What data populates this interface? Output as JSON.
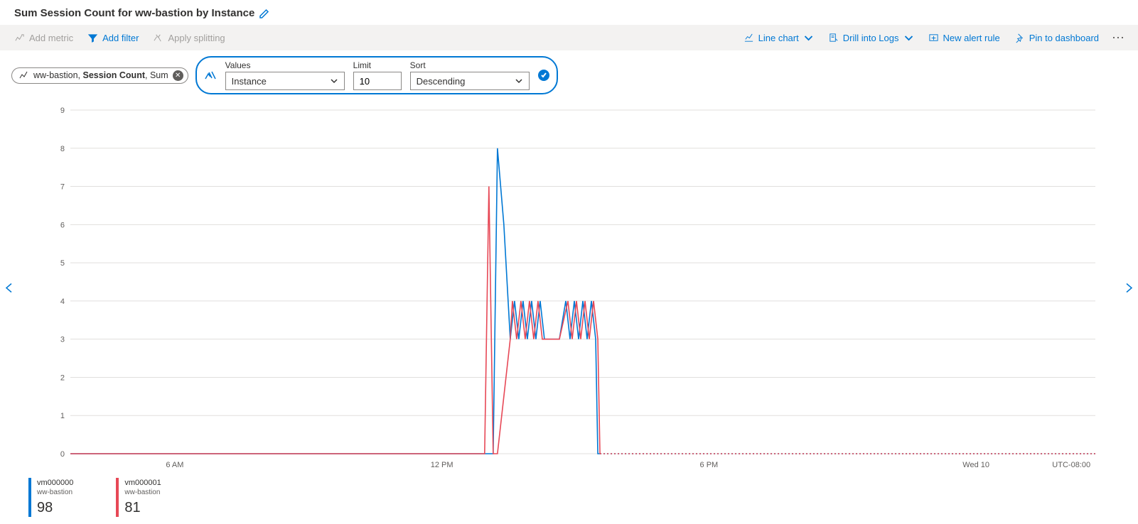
{
  "title": "Sum Session Count for ww-bastion by Instance",
  "toolbar": {
    "add_metric": "Add metric",
    "add_filter": "Add filter",
    "apply_splitting": "Apply splitting",
    "line_chart": "Line chart",
    "drill_logs": "Drill into Logs",
    "new_alert": "New alert rule",
    "pin": "Pin to dashboard"
  },
  "metric_pill": {
    "resource": "ww-bastion",
    "metric": "Session Count",
    "aggregation": "Sum"
  },
  "split": {
    "values_label": "Values",
    "values_selected": "Instance",
    "limit_label": "Limit",
    "limit_value": "10",
    "sort_label": "Sort",
    "sort_selected": "Descending"
  },
  "axis": {
    "x": [
      "6 AM",
      "12 PM",
      "6 PM",
      "Wed 10"
    ],
    "timezone": "UTC-08:00"
  },
  "legend": [
    {
      "instance": "vm000000",
      "resource": "ww-bastion",
      "total": "98",
      "color": "#0078d4"
    },
    {
      "instance": "vm000001",
      "resource": "ww-bastion",
      "total": "81",
      "color": "#e74856"
    }
  ],
  "chart_data": {
    "type": "line",
    "xlabel": "",
    "ylabel": "",
    "ylim": [
      0,
      9
    ],
    "yticks": [
      0,
      1,
      2,
      3,
      4,
      5,
      6,
      7,
      8,
      9
    ],
    "x_unit": "hour_of_day_local",
    "x_range_hours": [
      3,
      27
    ],
    "x_tick_labels": {
      "6": "6 AM",
      "12": "12 PM",
      "18": "6 PM",
      "24": "Wed 10"
    },
    "timezone": "UTC-08:00",
    "series": [
      {
        "name": "vm000000",
        "resource": "ww-bastion",
        "color": "#0078d4",
        "total": 98,
        "x": [
          3,
          12.9,
          13.0,
          13.15,
          13.3,
          13.4,
          13.5,
          13.6,
          13.7,
          13.8,
          13.9,
          14.0,
          14.1,
          14.2,
          14.3,
          14.4,
          14.45,
          14.6,
          14.7,
          14.8,
          14.9,
          15.0,
          15.1,
          15.2,
          15.3,
          15.35,
          15.4,
          27
        ],
        "values": [
          0,
          0,
          8,
          6,
          3,
          4,
          3,
          4,
          3,
          4,
          3,
          4,
          3,
          3,
          3,
          3,
          3,
          4,
          3,
          4,
          3,
          4,
          3,
          4,
          3,
          0,
          0,
          0
        ],
        "dotted_from_x": 15.4
      },
      {
        "name": "vm000001",
        "resource": "ww-bastion",
        "color": "#e74856",
        "total": 81,
        "x": [
          3,
          12.7,
          12.8,
          12.9,
          13.0,
          13.3,
          13.35,
          13.45,
          13.55,
          13.65,
          13.75,
          13.85,
          13.95,
          14.05,
          14.15,
          14.25,
          14.35,
          14.45,
          14.65,
          14.75,
          14.85,
          14.95,
          15.05,
          15.15,
          15.25,
          15.35,
          15.4,
          27
        ],
        "values": [
          0,
          0,
          7,
          0,
          0,
          3,
          4,
          3,
          4,
          3,
          4,
          3,
          4,
          3,
          3,
          3,
          3,
          3,
          4,
          3,
          4,
          3,
          4,
          3,
          4,
          3,
          0,
          0
        ],
        "dotted_from_x": 15.4
      }
    ]
  }
}
